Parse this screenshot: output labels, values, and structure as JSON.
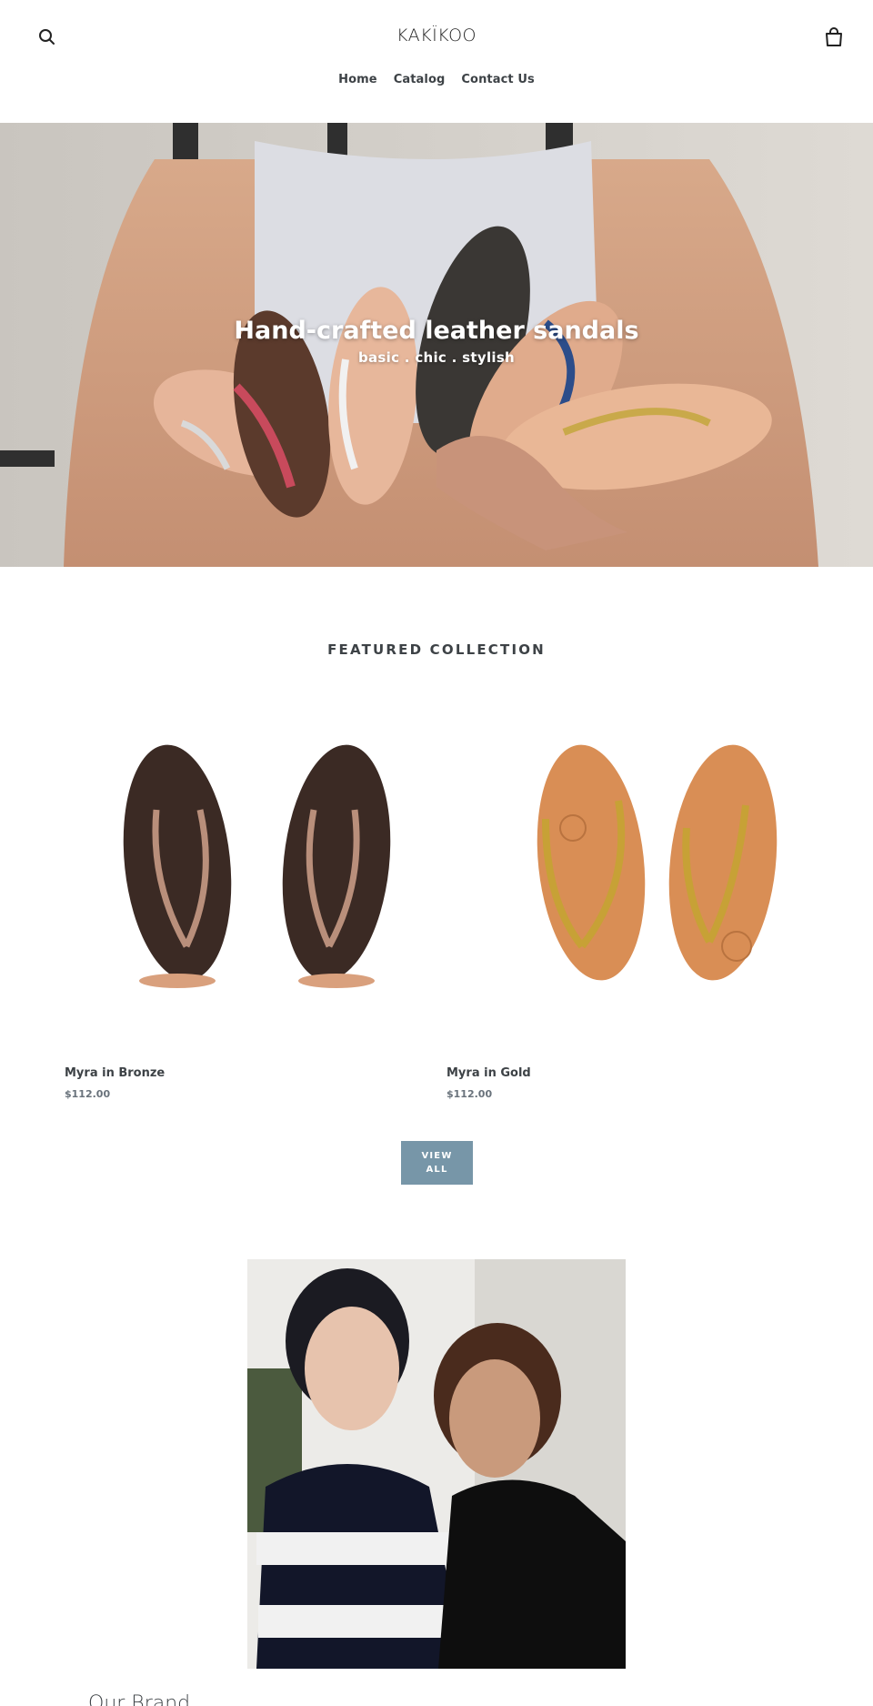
{
  "header": {
    "logo": "KAKÏKOO",
    "search_icon": "search-icon",
    "cart_icon": "cart-icon"
  },
  "nav": {
    "items": [
      {
        "label": "Home"
      },
      {
        "label": "Catalog"
      },
      {
        "label": "Contact Us"
      }
    ]
  },
  "hero": {
    "title": "Hand-crafted leather sandals",
    "subtitle": "basic . chic . stylish"
  },
  "featured": {
    "title": "FEATURED COLLECTION",
    "products": [
      {
        "name": "Myra in Bronze",
        "price": "$112.00"
      },
      {
        "name": "Myra in Gold",
        "price": "$112.00"
      }
    ],
    "view_all_label": "VIEW\nALL"
  },
  "brand": {
    "title": "Our Brand"
  },
  "colors": {
    "text": "#3d4246",
    "price": "#69727b",
    "button": "#7796a8"
  }
}
